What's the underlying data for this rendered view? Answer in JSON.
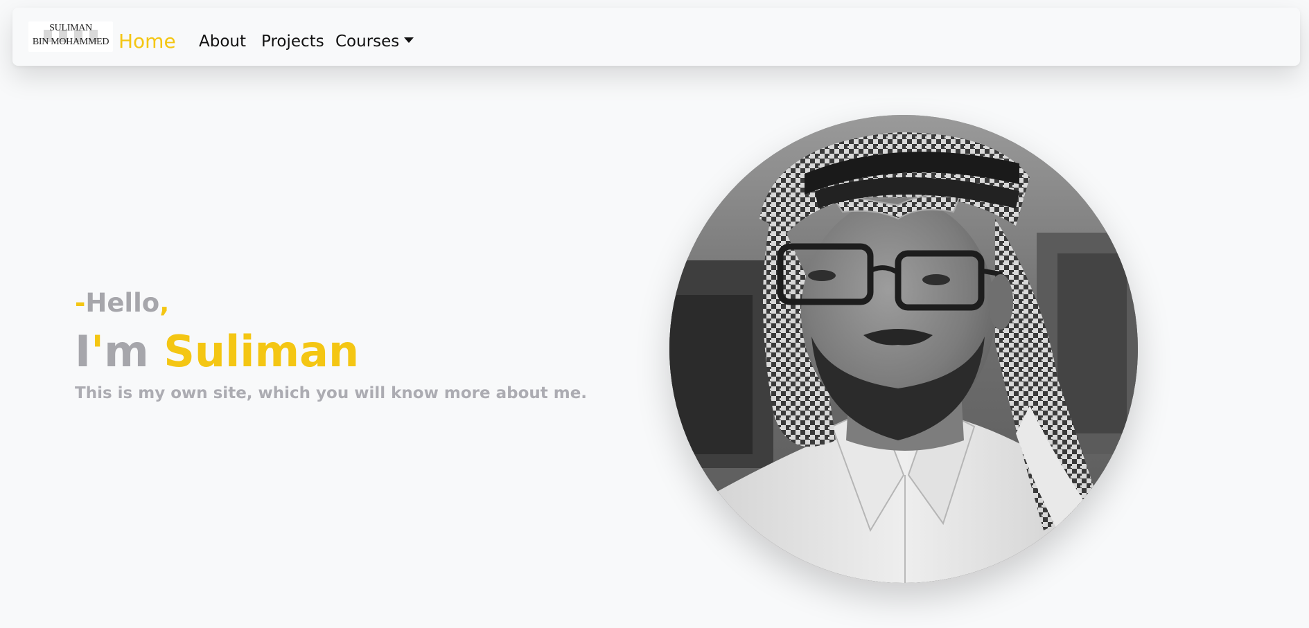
{
  "nav": {
    "brand": {
      "line1": "SULIMAN",
      "line2": "BIN MOHAMMED"
    },
    "links": {
      "home": "Home",
      "about": "About",
      "projects": "Projects",
      "courses": "Courses"
    },
    "active": "Home"
  },
  "hero": {
    "greeting_dash": "-",
    "greeting": "Hello",
    "greeting_comma": ",",
    "im_i": "I",
    "im_apostrophe": "'",
    "im_m": "m",
    "name": "Suliman",
    "tagline": "This is my own site, which you will know more about me."
  },
  "colors": {
    "accent": "#f4c613",
    "muted_text": "#a6a6ab",
    "background": "#f8f9fa"
  }
}
